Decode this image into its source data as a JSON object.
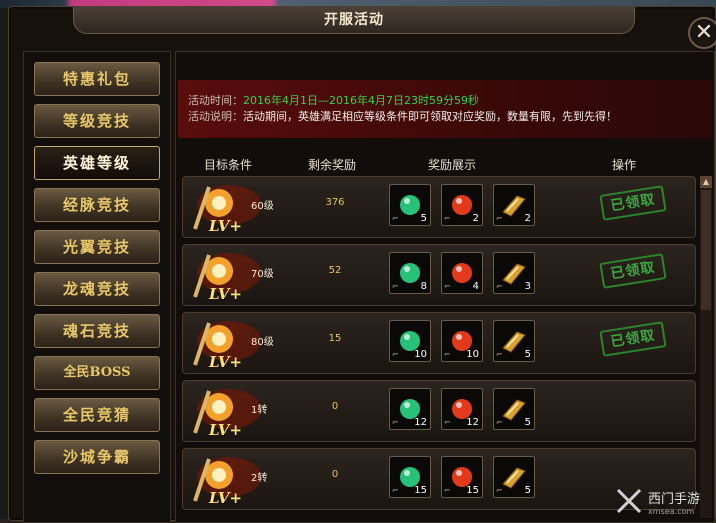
{
  "window": {
    "title": "开服活动"
  },
  "sidebar": {
    "items": [
      {
        "label": "特惠礼包"
      },
      {
        "label": "等级竞技"
      },
      {
        "label": "英雄等级"
      },
      {
        "label": "经脉竞技"
      },
      {
        "label": "光翼竞技"
      },
      {
        "label": "龙魂竞技"
      },
      {
        "label": "魂石竞技"
      },
      {
        "label": "全民BOSS"
      },
      {
        "label": "全民竞猜"
      },
      {
        "label": "沙城争霸"
      }
    ],
    "active": "英雄等级"
  },
  "info": {
    "time_label": "活动时间：",
    "time_value": "2016年4月1日—2016年4月7日23时59分59秒",
    "desc_label": "活动说明：",
    "desc_value": "活动期间，英雄满足相应等级条件即可领取对应奖励，数量有限，先到先得！"
  },
  "columns": {
    "target": "目标条件",
    "remaining": "剩余奖励",
    "rewards": "奖励展示",
    "action": "操作"
  },
  "rows": [
    {
      "level": "60级",
      "remaining": "376",
      "rewards": [
        "5",
        "2",
        "2"
      ],
      "claimed": "已领取"
    },
    {
      "level": "70级",
      "remaining": "52",
      "rewards": [
        "8",
        "4",
        "3"
      ],
      "claimed": "已领取"
    },
    {
      "level": "80级",
      "remaining": "15",
      "rewards": [
        "10",
        "10",
        "5"
      ],
      "claimed": "已领取"
    },
    {
      "level": "1转",
      "remaining": "0",
      "rewards": [
        "12",
        "12",
        "5"
      ],
      "claimed": ""
    },
    {
      "level": "2转",
      "remaining": "0",
      "rewards": [
        "15",
        "15",
        "5"
      ],
      "claimed": ""
    }
  ],
  "reward_items": [
    {
      "icon": "green-orb-icon",
      "color": "#27c27a"
    },
    {
      "icon": "red-orb-icon",
      "color": "#e23a1a"
    },
    {
      "icon": "gold-bar-icon",
      "color": "#d8a235"
    }
  ],
  "emblem_text": "LV+",
  "item_key_glyph": "⌐",
  "watermark": {
    "text": "西门手游",
    "sub": "xmsea.com"
  }
}
